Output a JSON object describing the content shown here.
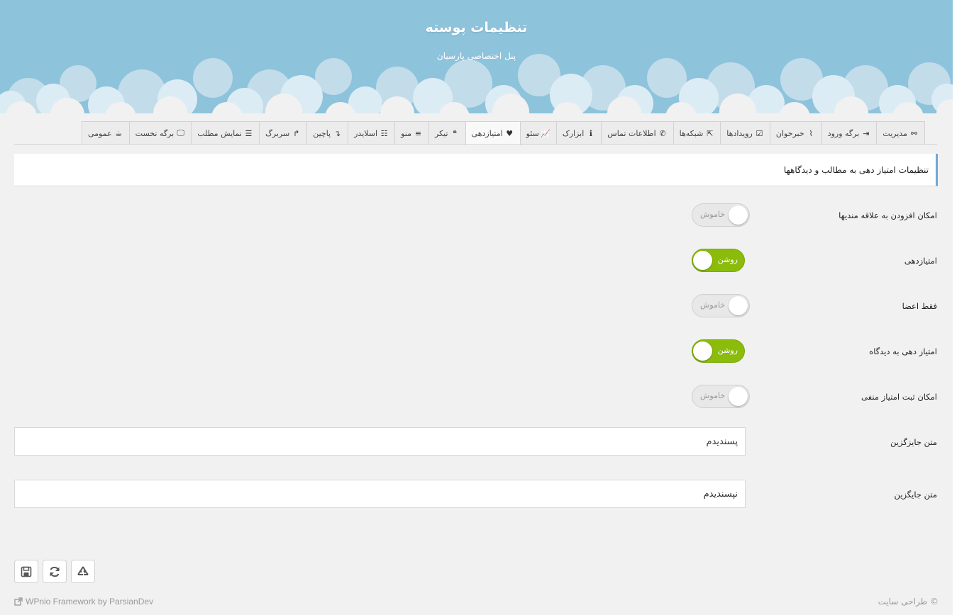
{
  "header": {
    "title": "تنظیمات پوسته",
    "subtitle": "پنل اختصاصی پارسیان"
  },
  "tabs": [
    {
      "label": "عمومی",
      "icon": "coffee-icon",
      "glyph": "☕"
    },
    {
      "label": "برگه نخست",
      "icon": "desktop-icon",
      "glyph": "🖵"
    },
    {
      "label": "نمایش مطلب",
      "icon": "align-justify-icon",
      "glyph": "☰"
    },
    {
      "label": "سربرگ",
      "icon": "level-up-icon",
      "glyph": "↱"
    },
    {
      "label": "پاچین",
      "icon": "level-down-icon",
      "glyph": "↴"
    },
    {
      "label": "اسلایدر",
      "icon": "sliders-icon",
      "glyph": "☷"
    },
    {
      "label": "منو",
      "icon": "bars-icon",
      "glyph": "≡"
    },
    {
      "label": "تیکر",
      "icon": "quote-icon",
      "glyph": "❝"
    },
    {
      "label": "امتیازدهی",
      "icon": "heart-icon",
      "glyph": "♥",
      "active": true
    },
    {
      "label": "سئو",
      "icon": "line-chart-icon",
      "glyph": "📈"
    },
    {
      "label": "ابزارک",
      "icon": "info-icon",
      "glyph": "ℹ"
    },
    {
      "label": "اطلاعات تماس",
      "icon": "phone-icon",
      "glyph": "✆"
    },
    {
      "label": "شبکه‌ها",
      "icon": "share-square-icon",
      "glyph": "⇱"
    },
    {
      "label": "رویدادها",
      "icon": "calendar-check-icon",
      "glyph": "☑"
    },
    {
      "label": "خبرخوان",
      "icon": "rss-icon",
      "glyph": "⌇"
    },
    {
      "label": "برگه ورود",
      "icon": "sign-in-icon",
      "glyph": "⇥"
    },
    {
      "label": "مدیریت",
      "icon": "binoculars-icon",
      "glyph": "⚯"
    }
  ],
  "section": {
    "title": "تنظیمات امتیاز دهی به مطالب و دیدگاهها"
  },
  "settings": [
    {
      "label": "امکان افزودن به علاقه مندیها",
      "state": "off",
      "state_label": "خاموش"
    },
    {
      "label": "امتیازدهی",
      "state": "on",
      "state_label": "روشن"
    },
    {
      "label": "فقط اعضا",
      "state": "off",
      "state_label": "خاموش"
    },
    {
      "label": "امتیاز دهی به دیدگاه",
      "state": "on",
      "state_label": "روشن"
    },
    {
      "label": "امکان ثبت امتیاز منفی",
      "state": "off",
      "state_label": "خاموش"
    }
  ],
  "fields": [
    {
      "label": "متن جایزگزین",
      "value": "پسندیدم"
    },
    {
      "label": "متن جایگزین",
      "value": "نپسندیدم"
    }
  ],
  "actions": {
    "save_icon": "save-icon",
    "refresh_icon": "refresh-icon",
    "reset_icon": "recycle-icon"
  },
  "footer": {
    "left": "WPnio Framework by ParsianDev",
    "right": "© طراحی سایت"
  },
  "colors": {
    "sky": "#8ec3dc",
    "toggle_on": "#8bbc0b",
    "accent": "#6fa8d6"
  }
}
